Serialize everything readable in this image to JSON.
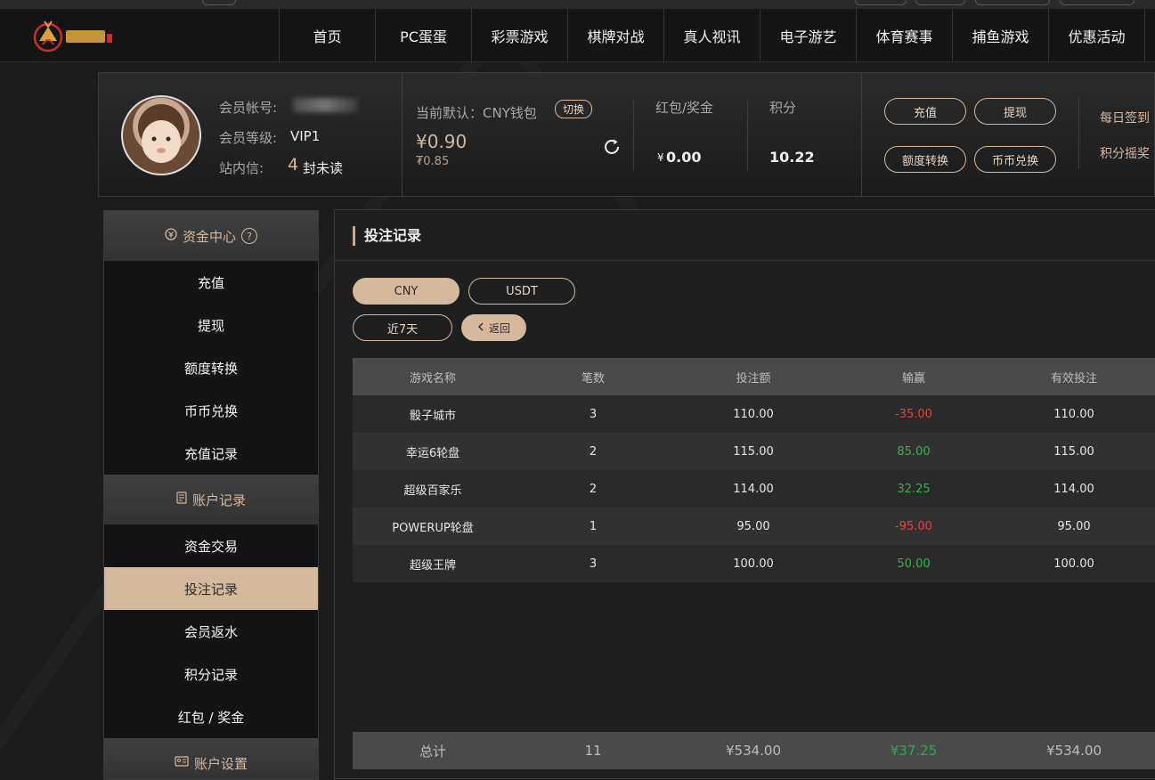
{
  "nav": {
    "items": [
      "首页",
      "PC蛋蛋",
      "彩票游戏",
      "棋牌对战",
      "真人视讯",
      "电子游艺",
      "体育赛事",
      "捕鱼游戏",
      "优惠活动"
    ]
  },
  "user": {
    "account_label": "会员帐号:",
    "level_label": "会员等级:",
    "level_value": "VIP1",
    "msg_label": "站内信:",
    "msg_count": "4",
    "msg_unit": "封未读"
  },
  "wallet": {
    "default_label": "当前默认：CNY钱包",
    "switch_label": "切换",
    "balance": "¥0.90",
    "balance_sub": "₮0.85",
    "refresh_icon": "refresh-icon"
  },
  "bonus": {
    "label": "红包/奖金",
    "currency": "¥",
    "value": "0.00"
  },
  "points": {
    "label": "积分",
    "value": "10.22"
  },
  "actions": {
    "deposit": "充值",
    "withdraw": "提现",
    "transfer": "额度转换",
    "exchange": "币币兑换",
    "daily_sign": "每日签到",
    "points_lottery": "积分摇奖"
  },
  "sidebar": {
    "section_funds": "资金中心",
    "section_funds_help": "?",
    "funds_items": [
      "充值",
      "提现",
      "额度转换",
      "币币兑换",
      "充值记录"
    ],
    "section_records": "账户记录",
    "records_items": [
      "资金交易",
      "投注记录",
      "会员返水",
      "积分记录",
      "红包 / 奖金"
    ],
    "section_settings": "账户设置"
  },
  "main": {
    "title": "投注记录",
    "currency_tabs": [
      "CNY",
      "USDT"
    ],
    "period": "近7天",
    "back": "返回",
    "columns": [
      "游戏名称",
      "笔数",
      "投注额",
      "输赢",
      "有效投注"
    ],
    "rows": [
      {
        "name": "骰子城市",
        "count": "3",
        "bet": "110.00",
        "win": "-35.00",
        "valid": "110.00",
        "status": "neg"
      },
      {
        "name": "幸运6轮盘",
        "count": "2",
        "bet": "115.00",
        "win": "85.00",
        "valid": "115.00",
        "status": "pos"
      },
      {
        "name": "超级百家乐",
        "count": "2",
        "bet": "114.00",
        "win": "32.25",
        "valid": "114.00",
        "status": "pos"
      },
      {
        "name": "POWERUP轮盘",
        "count": "1",
        "bet": "95.00",
        "win": "-95.00",
        "valid": "95.00",
        "status": "neg"
      },
      {
        "name": "超级王牌",
        "count": "3",
        "bet": "100.00",
        "win": "50.00",
        "valid": "100.00",
        "status": "pos"
      }
    ],
    "total": {
      "label": "总计",
      "count": "11",
      "bet": "¥534.00",
      "win": "¥37.25",
      "valid": "¥534.00"
    }
  },
  "colors": {
    "accent": "#d6b89c",
    "negative": "#e8403a",
    "positive": "#2fb54a"
  }
}
